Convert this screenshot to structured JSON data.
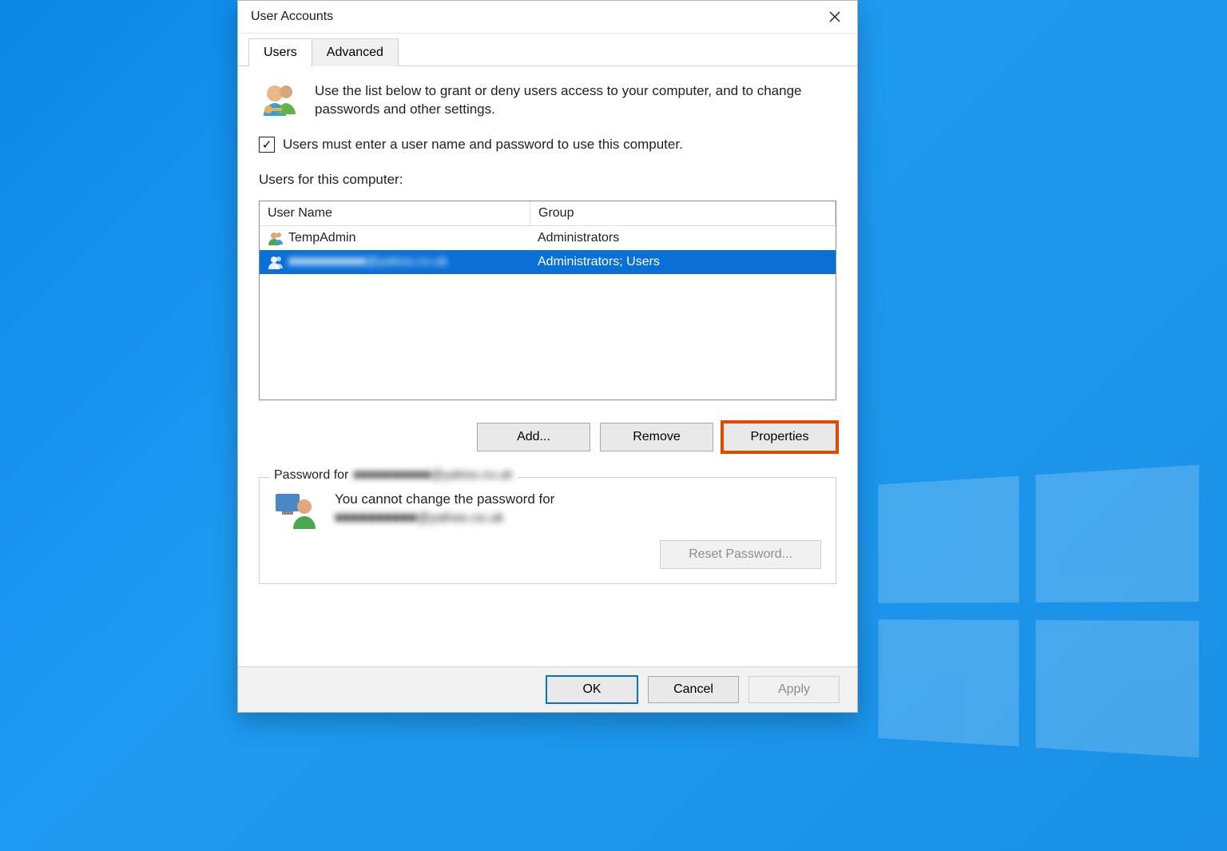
{
  "window": {
    "title": "User Accounts"
  },
  "tabs": {
    "users": "Users",
    "advanced": "Advanced"
  },
  "intro": "Use the list below to grant or deny users access to your computer, and to change passwords and other settings.",
  "checkbox": {
    "checked": true,
    "label": "Users must enter a user name and password to use this computer."
  },
  "list_label": "Users for this computer:",
  "columns": {
    "name": "User Name",
    "group": "Group"
  },
  "rows": [
    {
      "name": "TempAdmin",
      "group": "Administrators",
      "selected": false,
      "blurred": false
    },
    {
      "name": "■■■■■■■■■■@yahoo.co.uk",
      "group": "Administrators; Users",
      "selected": true,
      "blurred": true
    }
  ],
  "buttons": {
    "add": "Add...",
    "remove": "Remove",
    "properties": "Properties"
  },
  "password_section": {
    "legend_prefix": "Password for",
    "legend_user": "■■■■■■■■■■@yahoo.co.uk",
    "text_line1": "You cannot change the password for",
    "text_line2": "■■■■■■■■■■@yahoo.co.uk",
    "reset_button": "Reset Password..."
  },
  "footer": {
    "ok": "OK",
    "cancel": "Cancel",
    "apply": "Apply"
  }
}
